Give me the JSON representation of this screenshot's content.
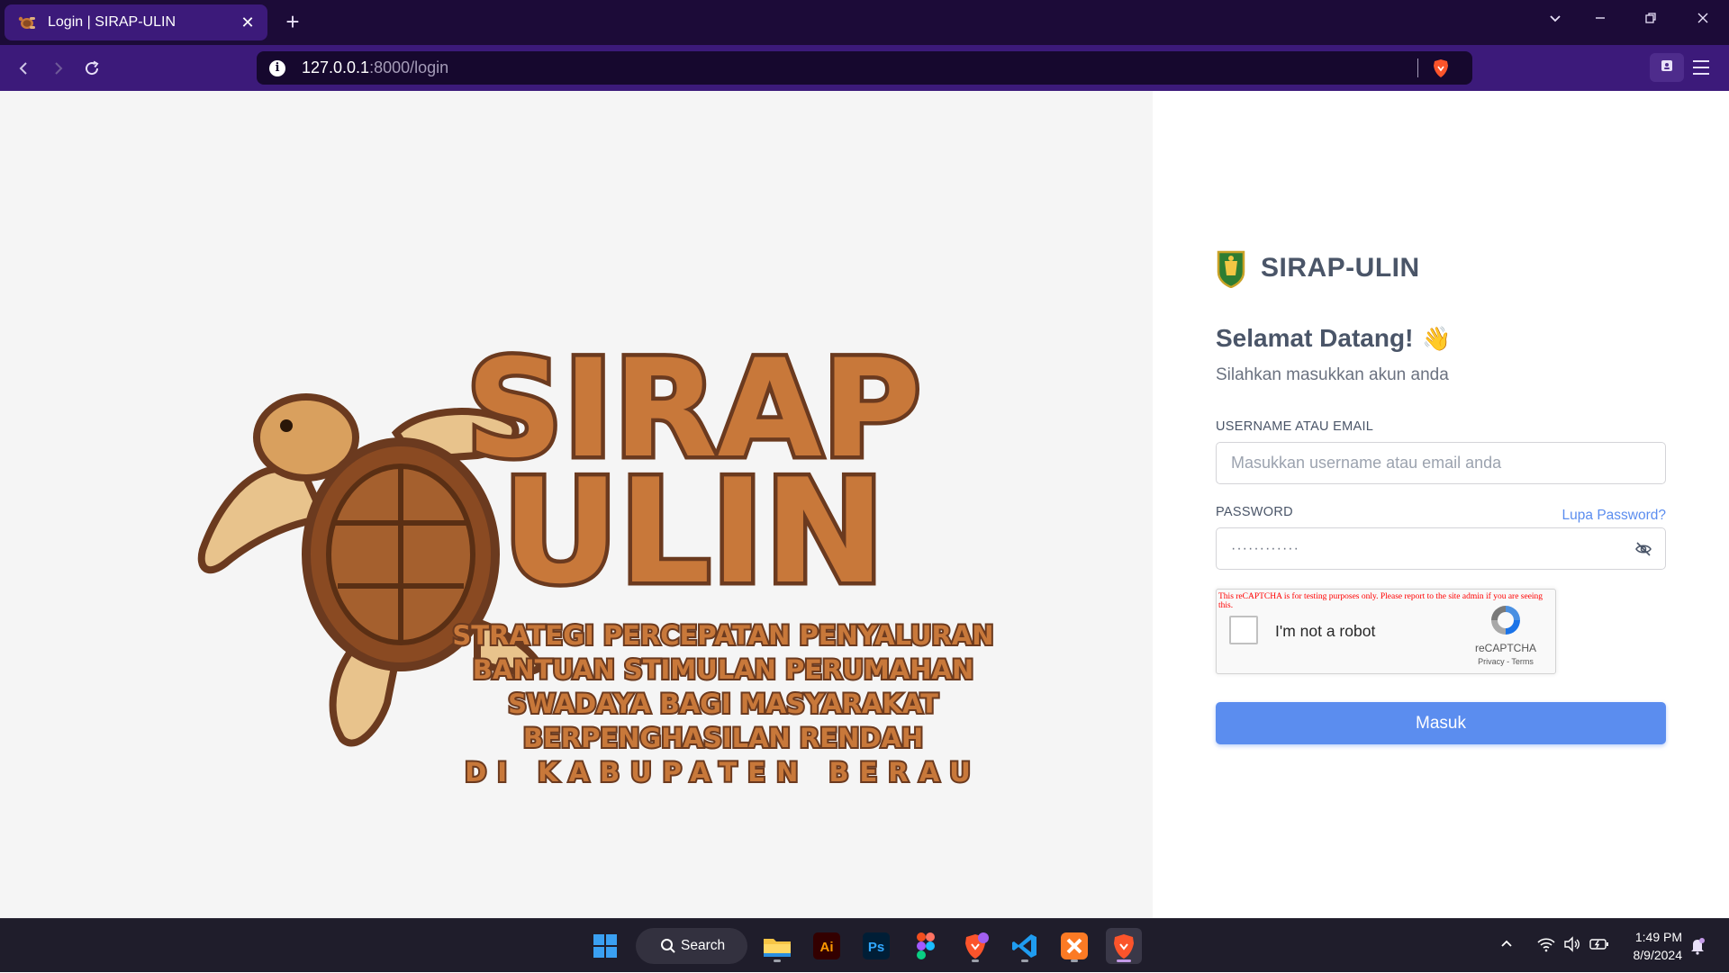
{
  "browser": {
    "tab_title": "Login | SIRAP-ULIN",
    "new_tab_symbol": "+",
    "close_tab_symbol": "✕",
    "url_host": "127.0.0.1",
    "url_path": ":8000/login",
    "window_controls": {
      "tab_search": "⌄",
      "minimize": "—",
      "restore": "❐",
      "close": "✕"
    },
    "accent_color": "#3c1a7a"
  },
  "logo": {
    "title_line1": "SIRAP",
    "title_line2": "ULIN",
    "tagline_lines": [
      "STRATEGI PERCEPATAN PENYALURAN",
      "BANTUAN STIMULAN PERUMAHAN",
      "SWADAYA BAGI MASYARAKAT",
      "BERPENGHASILAN RENDAH",
      "DI KABUPATEN BERAU"
    ],
    "primary_color": "#c8783a",
    "outline_color": "#6b3a1f"
  },
  "login": {
    "brand_name": "SIRAP-ULIN",
    "welcome_title": "Selamat Datang!",
    "welcome_emoji": "👋",
    "subtitle": "Silahkan masukkan akun anda",
    "username_label": "USERNAME ATAU EMAIL",
    "username_placeholder": "Masukkan username atau email anda",
    "password_label": "PASSWORD",
    "forgot_password": "Lupa Password?",
    "password_mask": "············",
    "submit_label": "Masuk",
    "button_color": "#5b8def"
  },
  "recaptcha": {
    "warning": "This reCAPTCHA is for testing purposes only. Please report to the site admin if you are seeing this.",
    "label": "I'm not a robot",
    "brand": "reCAPTCHA",
    "links": "Privacy - Terms"
  },
  "taskbar": {
    "search_label": "Search",
    "apps": [
      "windows-start",
      "file-explorer",
      "adobe-illustrator",
      "adobe-photoshop",
      "figma",
      "brave-nightly",
      "vscode",
      "xampp",
      "brave"
    ],
    "illustrator_label": "Ai",
    "photoshop_label": "Ps",
    "time": "1:49 PM",
    "date": "8/9/2024"
  }
}
